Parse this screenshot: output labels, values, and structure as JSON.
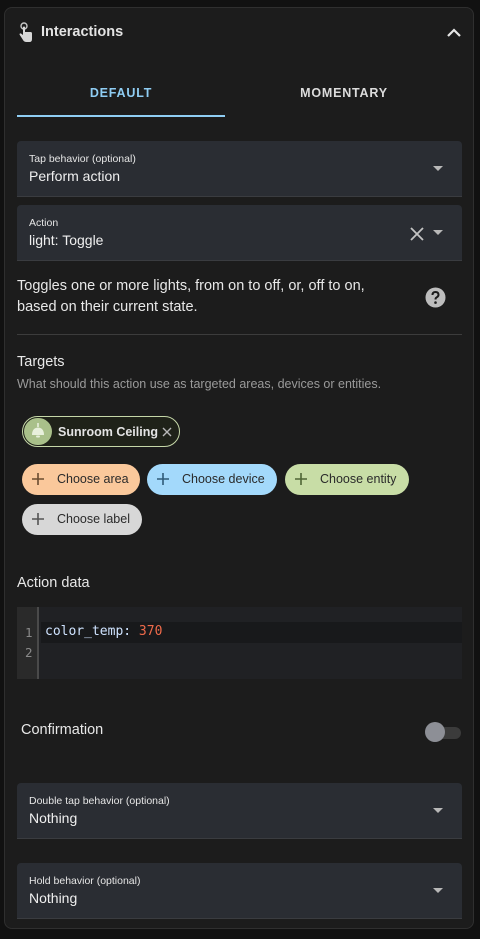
{
  "header": {
    "title": "Interactions",
    "icon": "tap-hand-icon",
    "collapse_icon": "chevron-up-icon"
  },
  "tabs": [
    {
      "label": "DEFAULT",
      "selected": true
    },
    {
      "label": "MOMENTARY",
      "selected": false
    }
  ],
  "tap_behavior": {
    "label": "Tap behavior (optional)",
    "value": "Perform action"
  },
  "action": {
    "label": "Action",
    "value": "light: Toggle"
  },
  "description": "Toggles one or more lights, from on to off, or, off to on, based on their current state.",
  "targets": {
    "title": "Targets",
    "subtitle": "What should this action use as targeted areas, devices or entities.",
    "selected_chip": "Sunroom Ceiling",
    "buttons": {
      "area": "Choose area",
      "device": "Choose device",
      "entity": "Choose entity",
      "label": "Choose label"
    }
  },
  "action_data": {
    "title": "Action data",
    "line_numbers": [
      "1",
      "2"
    ],
    "key": "color_temp:",
    "value": "370"
  },
  "confirmation": {
    "label": "Confirmation",
    "enabled": false
  },
  "double_tap_behavior": {
    "label": "Double tap behavior (optional)",
    "value": "Nothing"
  },
  "hold_behavior": {
    "label": "Hold behavior (optional)",
    "value": "Nothing"
  },
  "colors": {
    "accent": "#8fcdf3",
    "area": "#fac89b",
    "device": "#a3d9fb",
    "entity": "#c8dda6",
    "label": "#d7d7d7",
    "code_value": "#ef6a4a"
  }
}
